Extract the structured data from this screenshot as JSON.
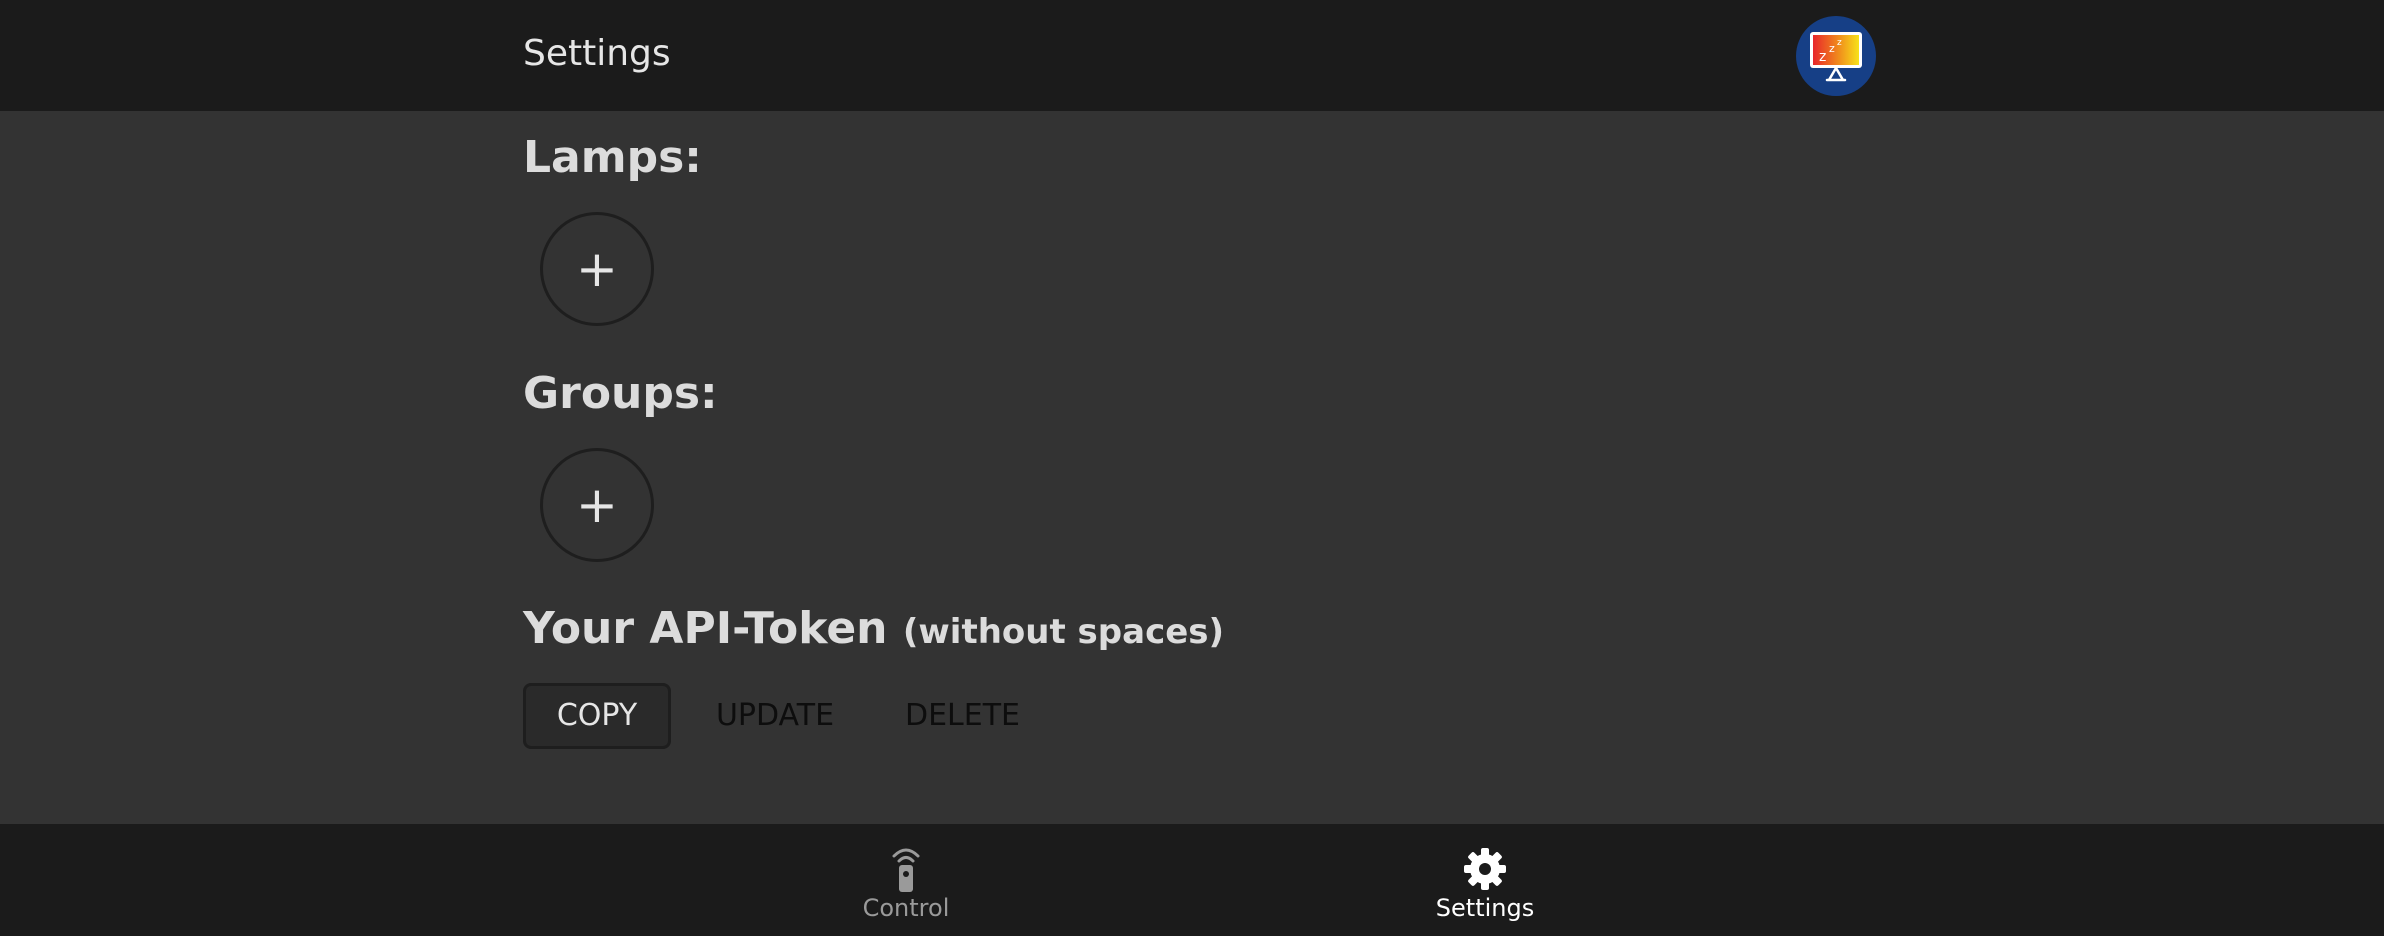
{
  "header": {
    "title": "Settings",
    "logo_icon": "sleeping-monitor-icon"
  },
  "sections": {
    "lamps": {
      "heading": "Lamps:",
      "add_symbol": "+"
    },
    "groups": {
      "heading": "Groups:",
      "add_symbol": "+"
    },
    "token": {
      "heading": "Your API-Token",
      "note": "(without spaces)"
    }
  },
  "actions": {
    "copy": "COPY",
    "update": "UPDATE",
    "delete": "DELETE"
  },
  "nav": {
    "control": {
      "label": "Control",
      "icon": "remote-control-icon",
      "active": false
    },
    "settings": {
      "label": "Settings",
      "icon": "gear-icon",
      "active": true
    }
  },
  "colors": {
    "topbar": "#1b1b1b",
    "background": "#333333",
    "logo_bg": "#163f86"
  }
}
